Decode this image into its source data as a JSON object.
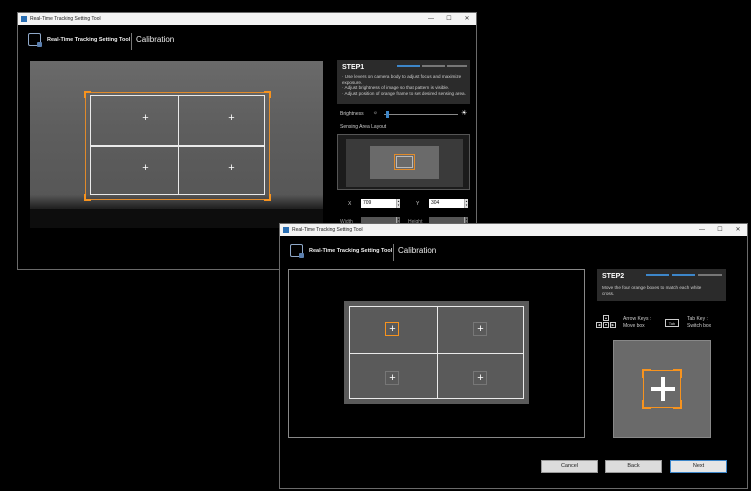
{
  "app": {
    "window_title": "Real-Time Tracking Setting Tool",
    "app_name": "Real-Time Tracking Setting Tool",
    "page_title": "Calibration",
    "window_controls": {
      "minimize": "—",
      "maximize": "☐",
      "close": "✕"
    }
  },
  "step1": {
    "title": "STEP1",
    "progress": {
      "total_segments": 3,
      "active_segments": 1
    },
    "lines": [
      "· Use levers on camera body to adjust focus and maximize",
      "  exposure.",
      "· Adjust brightness of image so that pattern is visible.",
      "· Adjust position of orange frame to set desired sensing area."
    ],
    "brightness_label": "Brightness",
    "brightness_level": 0.03,
    "sensing_area_label": "Sensing Area Layout",
    "x_label": "X",
    "x_value": "709",
    "y_label": "Y",
    "y_value": "304",
    "width_label": "Width",
    "height_label": "Height",
    "plus_marks": [
      "+",
      "+",
      "+",
      "+"
    ]
  },
  "step2": {
    "title": "STEP2",
    "progress": {
      "total_segments": 3,
      "active_segments": 2
    },
    "description": "Move the four orange boxes to match each white cross.",
    "arrow_keys_label": "Arrow Keys :",
    "arrow_keys_action": "Move box",
    "tab_key_label": "Tab Key :",
    "tab_key_action": "Switch box",
    "tab_key_cap": "Tab",
    "plus_marks": [
      "+",
      "+",
      "+",
      "+"
    ],
    "buttons": {
      "cancel": "Cancel",
      "back": "Back",
      "next": "Next"
    }
  },
  "colors": {
    "accent_orange": "#f7931e",
    "accent_blue": "#3d86c9",
    "panel_bg": "#2b2b2b"
  },
  "icons": [
    "app-logo-icon",
    "sun-dim-icon",
    "sun-bright-icon",
    "arrow-keys-icon",
    "tab-key-icon"
  ]
}
